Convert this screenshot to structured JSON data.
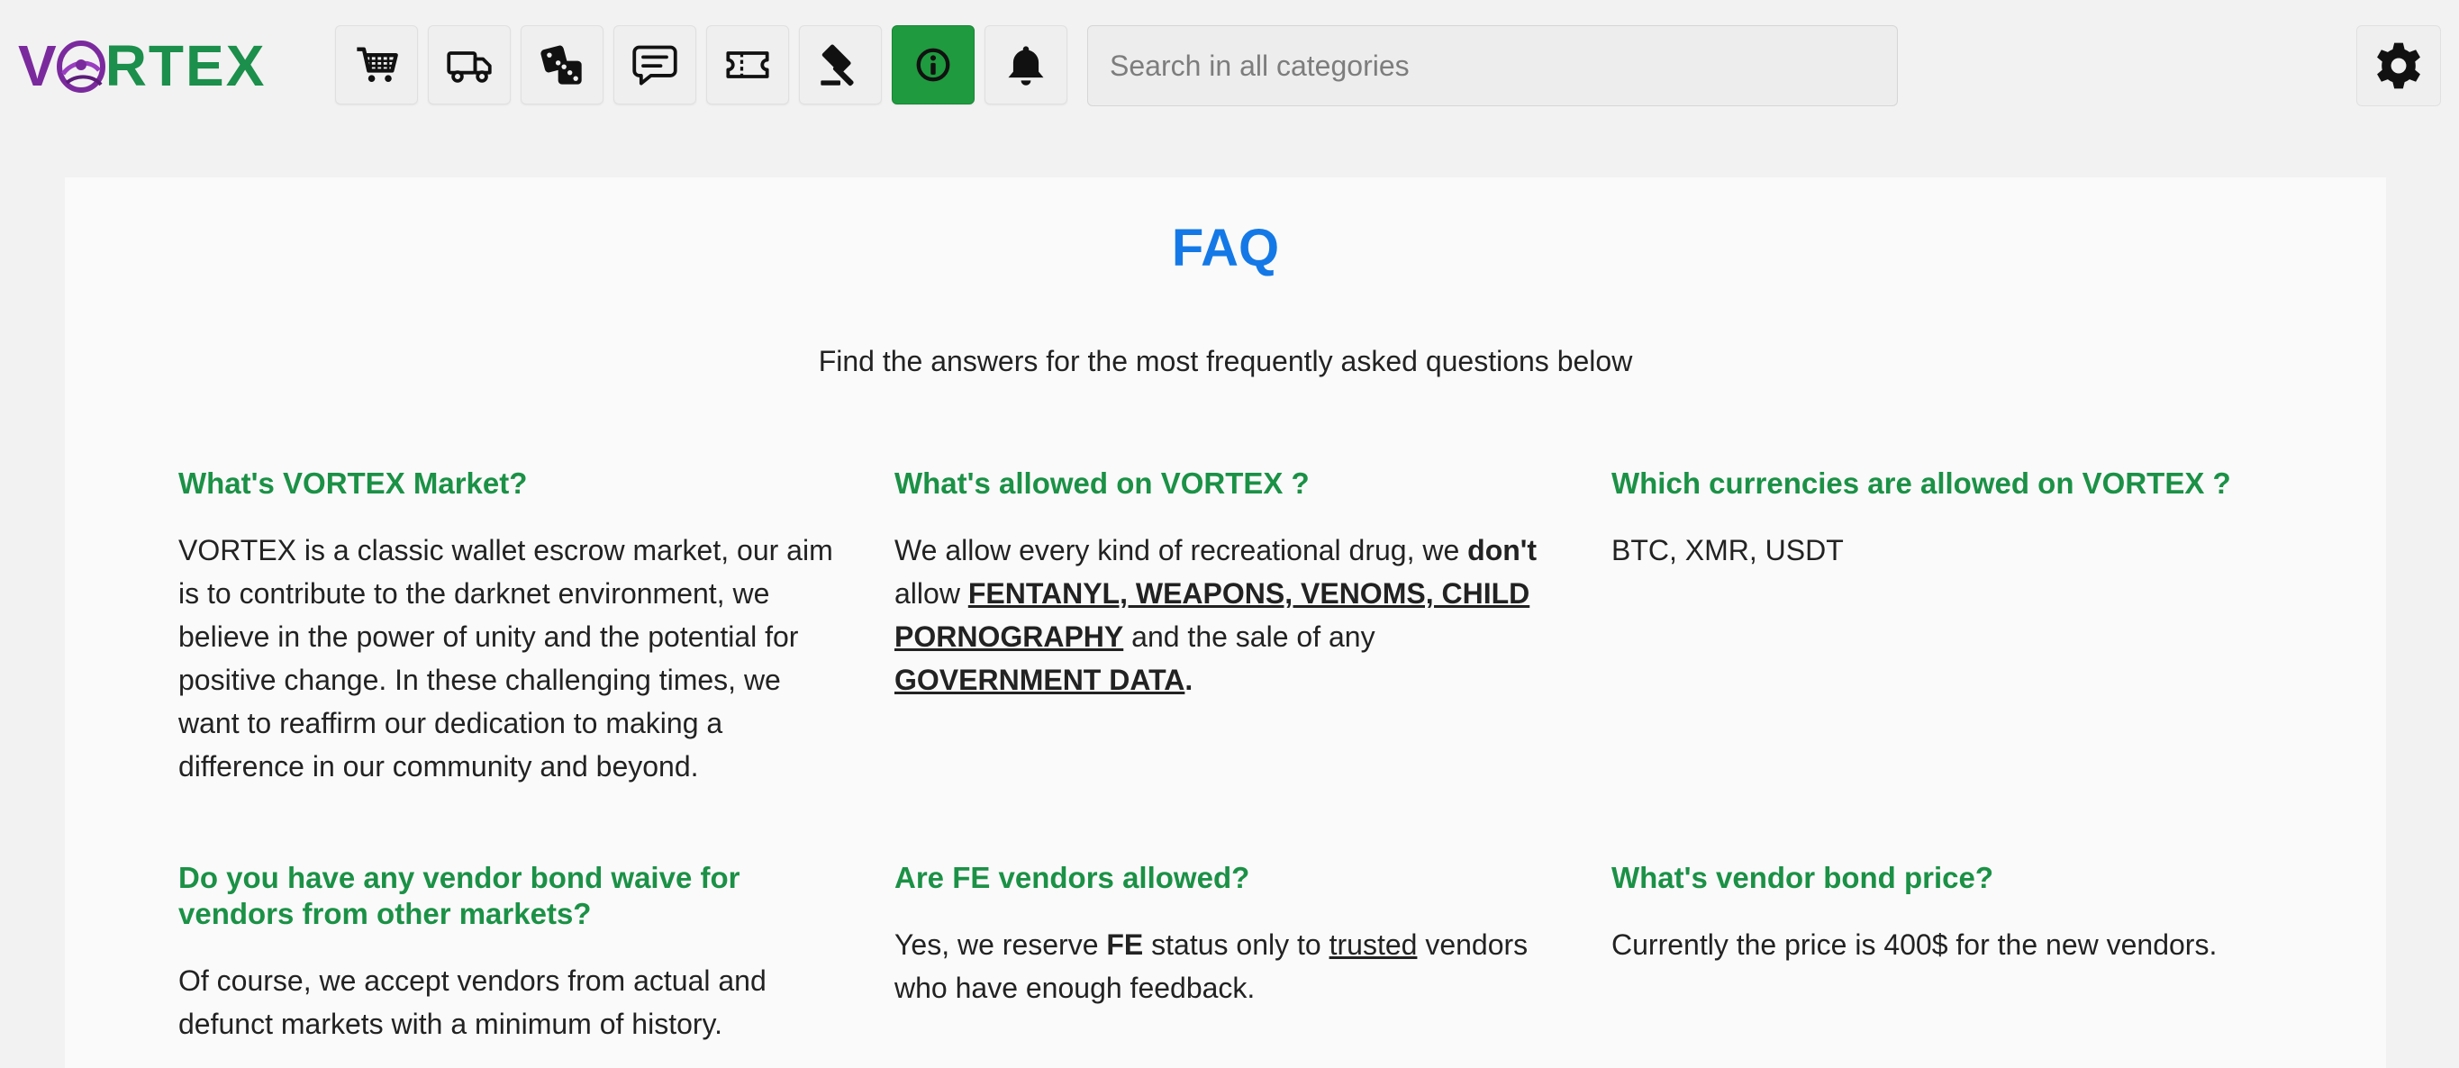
{
  "brand": {
    "logo_first": "V",
    "logo_rest": "RTEX",
    "logo_colors": {
      "purple": "#7b2a9e",
      "green": "#1b8f4b"
    }
  },
  "toolbar": {
    "icons": [
      {
        "name": "cart-icon",
        "active": false
      },
      {
        "name": "truck-icon",
        "active": false
      },
      {
        "name": "dice-icon",
        "active": false
      },
      {
        "name": "message-icon",
        "active": false
      },
      {
        "name": "ticket-icon",
        "active": false
      },
      {
        "name": "gavel-icon",
        "active": false
      },
      {
        "name": "info-icon",
        "active": true
      },
      {
        "name": "bell-icon",
        "active": false
      }
    ],
    "active_color": "#1f9a3f"
  },
  "search": {
    "placeholder": "Search in all categories",
    "value": ""
  },
  "settings": {
    "icon": "gear-icon"
  },
  "faq": {
    "title": "FAQ",
    "subtitle": "Find the answers for the most frequently asked questions below",
    "title_color": "#1479e6",
    "question_color": "#1b9146",
    "items": [
      {
        "question": "What's VORTEX Market?",
        "answer": "VORTEX is a classic wallet escrow market, our aim is to contribute to the darknet environment, we believe in the power of unity and the potential for positive change. In these challenging times, we want to reaffirm our dedication to making a difference in our community and beyond."
      },
      {
        "question": "What's allowed on VORTEX ?",
        "answer_parts": {
          "p1": "We allow every kind of recreational drug, we ",
          "b1": "don't",
          "p2": " allow ",
          "u1": "FENTANYL, WEAPONS, VENOMS, CHILD PORNOGRAPHY",
          "p3": " and the sale of any ",
          "u2": "GOVERNMENT DATA",
          "p4": "."
        }
      },
      {
        "question": "Which currencies are allowed on VORTEX ?",
        "answer": "BTC, XMR, USDT"
      },
      {
        "question": "Do you have any vendor bond waive for vendors from other markets?",
        "answer": "Of course, we accept vendors from actual and defunct markets with a minimum of history."
      },
      {
        "question": "Are FE vendors allowed?",
        "answer_parts": {
          "p1": "Yes, we reserve ",
          "b1": "FE",
          "p2": " status only to ",
          "u1": "trusted",
          "p3": " vendors who have enough feedback."
        }
      },
      {
        "question": "What's vendor bond price?",
        "answer": "Currently the price is 400$ for the new vendors."
      }
    ]
  }
}
